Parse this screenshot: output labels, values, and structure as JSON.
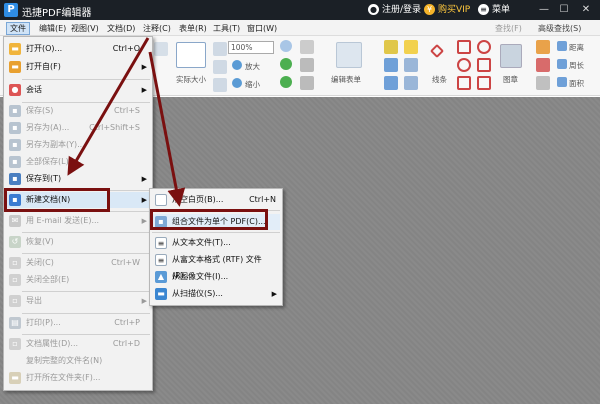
{
  "title_bar": {
    "logo": "P",
    "app_title": "迅捷PDF编辑器",
    "account": "注册/登录",
    "vip": "购买VIP",
    "menu": "菜单",
    "minimize": "—",
    "maximize": "☐",
    "close": "✕"
  },
  "menu_bar": {
    "items": [
      "文件",
      "编辑(E)",
      "视图(V)",
      "文档(D)",
      "注释(C)",
      "表单(R)",
      "工具(T)",
      "窗口(W)"
    ],
    "find": "查找(F)",
    "advanced_find": "高级查找(S)"
  },
  "toolbar": {
    "zoom": "100%",
    "actual_size": "实际大小",
    "zoom_in": "放大",
    "zoom_out": "缩小",
    "edit_form": "编辑表单",
    "lines": "线条",
    "stamp": "图章",
    "distance": "距离",
    "perimeter": "周长",
    "area": "面积"
  },
  "file_menu": {
    "items": [
      {
        "label": "打开(O)...",
        "shortcut": "Ctrl+O",
        "enabled": true
      },
      {
        "label": "打开自(F)",
        "shortcut": "",
        "enabled": true,
        "submenu": true
      },
      {
        "label": "会话",
        "shortcut": "",
        "enabled": true,
        "submenu": true
      },
      {
        "label": "保存(S)",
        "shortcut": "Ctrl+S",
        "enabled": false
      },
      {
        "label": "另存为(A)...",
        "shortcut": "Ctrl+Shift+S",
        "enabled": false
      },
      {
        "label": "另存为副本(Y)...",
        "shortcut": "",
        "enabled": false
      },
      {
        "label": "全部保存(L)",
        "shortcut": "",
        "enabled": false
      },
      {
        "label": "保存到(T)",
        "shortcut": "",
        "enabled": true,
        "submenu": true
      },
      {
        "label": "新建文档(N)",
        "shortcut": "",
        "enabled": true,
        "submenu": true
      },
      {
        "label": "用 E-mail 发送(E)...",
        "shortcut": "",
        "enabled": false,
        "submenu": true
      },
      {
        "label": "恢复(V)",
        "shortcut": "",
        "enabled": false
      },
      {
        "label": "关闭(C)",
        "shortcut": "Ctrl+W",
        "enabled": false
      },
      {
        "label": "关闭全部(E)",
        "shortcut": "",
        "enabled": false
      },
      {
        "label": "导出",
        "shortcut": "",
        "enabled": false,
        "submenu": true
      },
      {
        "label": "打印(P)...",
        "shortcut": "Ctrl+P",
        "enabled": false
      },
      {
        "label": "文档属性(D)...",
        "shortcut": "Ctrl+D",
        "enabled": false
      },
      {
        "label": "复制完整的文件名(N)",
        "shortcut": "",
        "enabled": false
      },
      {
        "label": "打开所在文件夹(F)...",
        "shortcut": "",
        "enabled": false
      }
    ]
  },
  "new_doc_submenu": {
    "items": [
      {
        "label": "从空白页(B)...",
        "shortcut": "Ctrl+N"
      },
      {
        "label": "组合文件为单个 PDF(C)...",
        "shortcut": ""
      },
      {
        "label": "从文本文件(T)...",
        "shortcut": ""
      },
      {
        "label": "从富文本格式 (RTF) 文件(R)...",
        "shortcut": ""
      },
      {
        "label": "从图像文件(I)...",
        "shortcut": ""
      },
      {
        "label": "从扫描仪(S)...",
        "shortcut": "",
        "submenu": true
      }
    ]
  },
  "colors": {
    "title_bg": "#1b2026",
    "highlight": "#7a1010",
    "vip": "#ffc83d"
  }
}
